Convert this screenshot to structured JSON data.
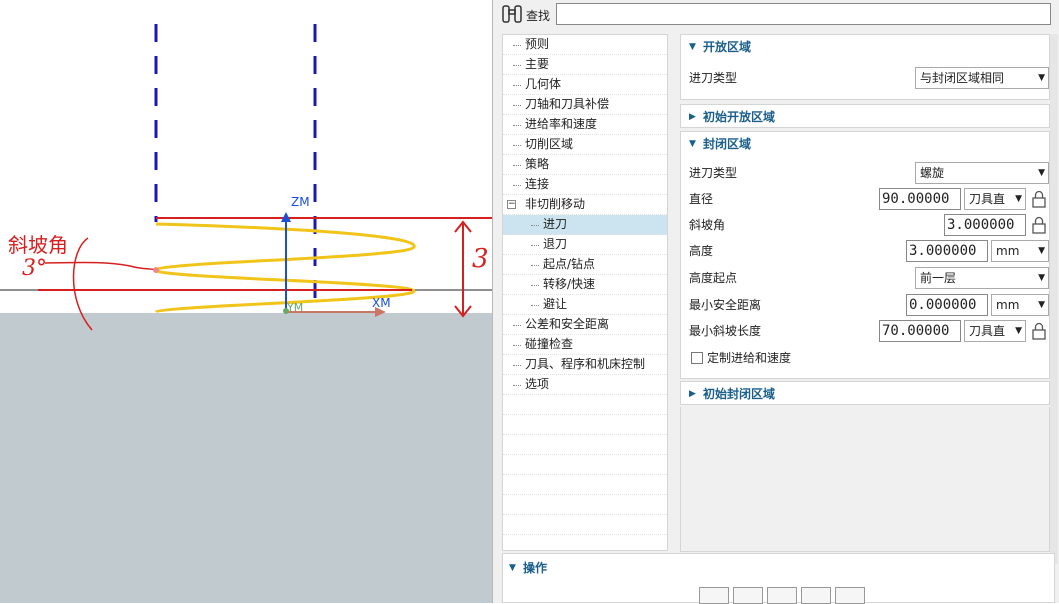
{
  "viewport": {
    "axis_z": "ZM",
    "axis_x": "XM",
    "axis_y": "YM",
    "annot_ramp_label": "斜坡角",
    "annot_angle": "3°",
    "annot_height": "3",
    "colors": {
      "ground": "#c0cacf",
      "helix": "#f0c419",
      "red": "#d62020",
      "axis": "#1a4fd6",
      "tool": "#1a1ab0"
    }
  },
  "search": {
    "label": "查找",
    "value": ""
  },
  "tree": {
    "items": [
      {
        "label": "预则",
        "level": 0
      },
      {
        "label": "主要",
        "level": 0
      },
      {
        "label": "几何体",
        "level": 0
      },
      {
        "label": "刀轴和刀具补偿",
        "level": 0
      },
      {
        "label": "进给率和速度",
        "level": 0
      },
      {
        "label": "切削区域",
        "level": 0
      },
      {
        "label": "策略",
        "level": 0
      },
      {
        "label": "连接",
        "level": 0
      },
      {
        "label": "非切削移动",
        "level": 0,
        "expander": "−"
      },
      {
        "label": "进刀",
        "level": 1,
        "selected": true
      },
      {
        "label": "退刀",
        "level": 1
      },
      {
        "label": "起点/钻点",
        "level": 1
      },
      {
        "label": "转移/快速",
        "level": 1
      },
      {
        "label": "避让",
        "level": 1
      },
      {
        "label": "公差和安全距离",
        "level": 0
      },
      {
        "label": "碰撞检查",
        "level": 0
      },
      {
        "label": "刀具、程序和机床控制",
        "level": 0
      },
      {
        "label": "选项",
        "level": 0
      }
    ]
  },
  "open_area": {
    "title": "开放区域",
    "engage_type_label": "进刀类型",
    "engage_type_value": "与封闭区域相同"
  },
  "initial_open_area": {
    "title": "初始开放区域"
  },
  "closed_area": {
    "title": "封闭区域",
    "engage_type_label": "进刀类型",
    "engage_type_value": "螺旋",
    "diameter_label": "直径",
    "diameter_value": "90.00000",
    "diameter_unit": "刀具直",
    "ramp_angle_label": "斜坡角",
    "ramp_angle_value": "3.000000",
    "height_label": "高度",
    "height_value": "3.000000",
    "height_unit": "mm",
    "height_from_label": "高度起点",
    "height_from_value": "前一层",
    "min_clearance_label": "最小安全距离",
    "min_clearance_value": "0.000000",
    "min_clearance_unit": "mm",
    "min_ramp_len_label": "最小斜坡长度",
    "min_ramp_len_value": "70.00000",
    "min_ramp_len_unit": "刀具直",
    "custom_feed_label": "定制进给和速度"
  },
  "initial_closed_area": {
    "title": "初始封闭区域"
  },
  "operations": {
    "title": "操作"
  }
}
